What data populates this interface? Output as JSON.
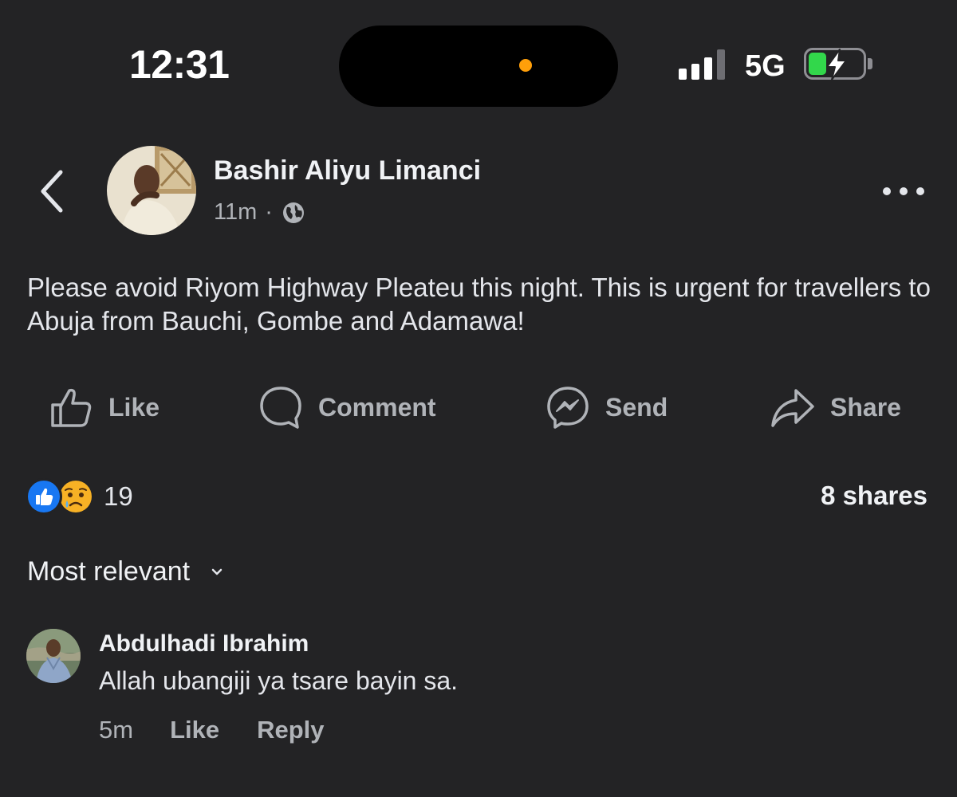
{
  "status_bar": {
    "time": "12:31",
    "network": "5G",
    "battery_color": "#32d74b"
  },
  "post": {
    "author": "Bashir Aliyu Limanci",
    "time": "11m",
    "separator": "·",
    "privacy_icon": "globe-icon",
    "text": "Please avoid Riyom Highway Pleateu this night. This is urgent for travellers to Abuja  from Bauchi, Gombe and Adamawa!"
  },
  "actions": {
    "like": "Like",
    "comment": "Comment",
    "send": "Send",
    "share": "Share"
  },
  "stats": {
    "reactions_count": "19",
    "reaction_icons": [
      "like-reaction-icon",
      "sad-reaction-icon"
    ],
    "shares": "8 shares"
  },
  "comments_sort": "Most relevant",
  "comments": [
    {
      "name": "Abdulhadi Ibrahim",
      "text": "Allah ubangiji ya tsare bayin sa.",
      "time": "5m",
      "like": "Like",
      "reply": "Reply"
    }
  ],
  "colors": {
    "background": "#232325",
    "accent": "#1877f2",
    "secondary_text": "#b0b3b8"
  }
}
